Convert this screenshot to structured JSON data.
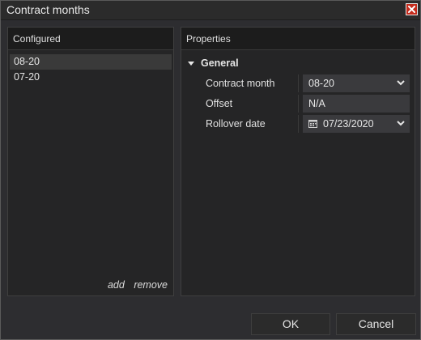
{
  "window": {
    "title": "Contract months"
  },
  "configured": {
    "header": "Configured",
    "items": [
      {
        "label": "08-20",
        "selected": true
      },
      {
        "label": "07-20",
        "selected": false
      }
    ],
    "add_label": "add",
    "remove_label": "remove"
  },
  "properties": {
    "header": "Properties",
    "group_label": "General",
    "contract_month": {
      "label": "Contract month",
      "value": "08-20"
    },
    "offset": {
      "label": "Offset",
      "value": "N/A"
    },
    "rollover_date": {
      "label": "Rollover date",
      "value": "07/23/2020"
    }
  },
  "buttons": {
    "ok": "OK",
    "cancel": "Cancel"
  },
  "colors": {
    "close_button": "#c42b1c",
    "background": "#2d2d30"
  }
}
